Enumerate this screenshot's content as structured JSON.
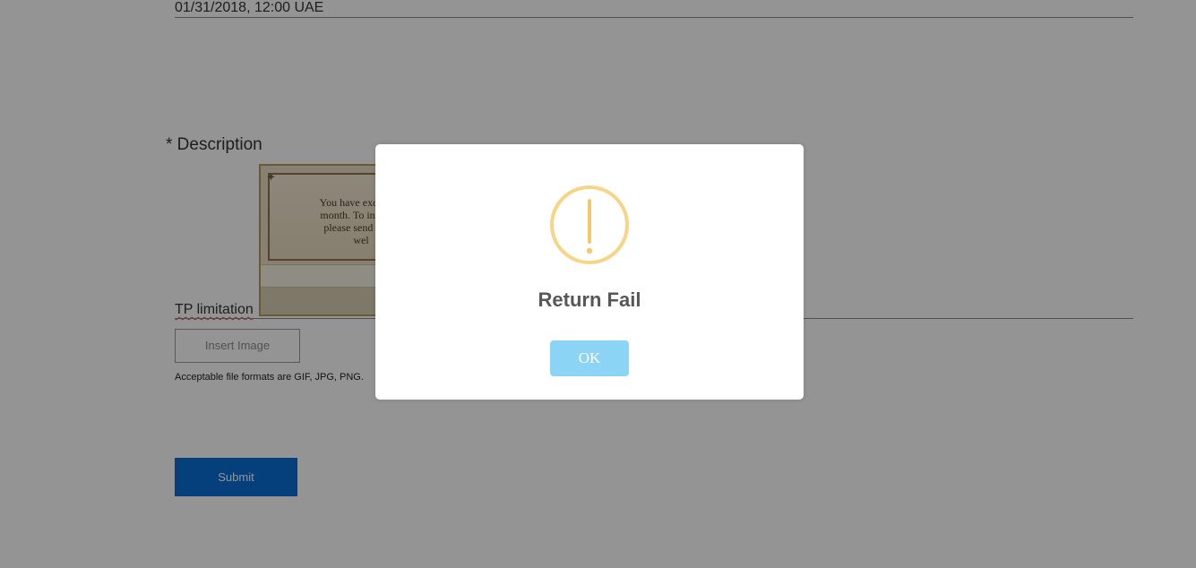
{
  "form": {
    "date_value": "01/31/2018, 12:00 UAE",
    "description_label": "* Description",
    "thumbnail": {
      "text": "You have exceeded\nmonth. To increase\nplease send us a t\nwel"
    },
    "tp_label": "TP limitation",
    "insert_image_label": "Insert Image",
    "formats_note": "Acceptable file formats are GIF, JPG, PNG.",
    "submit_label": "Submit"
  },
  "dialog": {
    "icon": "exclamation-circle-icon",
    "title": "Return Fail",
    "ok_label": "OK"
  },
  "colors": {
    "warning": "#f8d486",
    "ok_button": "#8cd4f5",
    "submit_button": "#0a6fd8"
  }
}
